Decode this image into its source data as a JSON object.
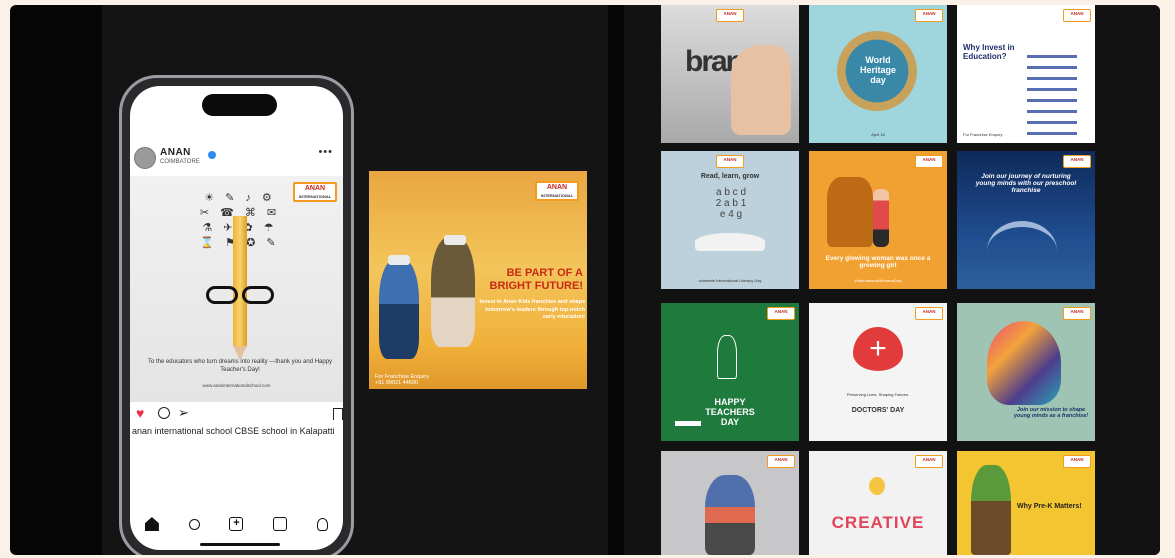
{
  "instagram_post": {
    "account_name": "ANAN",
    "account_location": "COIMBATORE",
    "more_icon": "ellipsis-icon",
    "brand_logo": "ANAN INTERNATIONAL SCHOOL",
    "message": "To the educators who turn dreams into reality —thank you and Happy Teacher's Day!",
    "website": "www.ananinternationalschool.com",
    "caption": "anan international school   CBSE school in Kalapatti",
    "liked": true
  },
  "franchise_post": {
    "headline": "BE PART OF A BRIGHT FUTURE!",
    "body": "Invest in Anan Kids franchise and shape tomorrow's leaders through top-notch early education!",
    "enquiry_label": "For Franchise Enquiry",
    "enquiry_phone": "+91 99021 44600"
  },
  "grid_tiles": [
    {
      "text": "brand",
      "sub": ""
    },
    {
      "text": "World Heritage day",
      "sub": "April 18"
    },
    {
      "text": "Why Invest in Education?",
      "sub": "For Franchise Enquiry"
    },
    {
      "text": "Read, learn, grow",
      "sub": "celebrate International Literacy Day"
    },
    {
      "text": "Every glowing woman was once a growing girl",
      "sub": "#InternationalWomensDay"
    },
    {
      "text": "Join our journey of nurturing young minds with our preschool franchise",
      "sub": ""
    },
    {
      "text": "HAPPY TEACHERS DAY",
      "sub": ""
    },
    {
      "text": "DOCTORS' DAY",
      "sub": "Preserving Lives, Shaping Futures."
    },
    {
      "text": "Join our mission to shape young minds as a franchise!",
      "sub": ""
    },
    {
      "text": "",
      "sub": ""
    },
    {
      "text": "CREATIVE",
      "sub": ""
    },
    {
      "text": "Why Pre-K Matters!",
      "sub": ""
    }
  ],
  "colors": {
    "accent_orange": "#f29b1d",
    "like_red": "#ed2f4e",
    "frame_dark": "#050505"
  }
}
